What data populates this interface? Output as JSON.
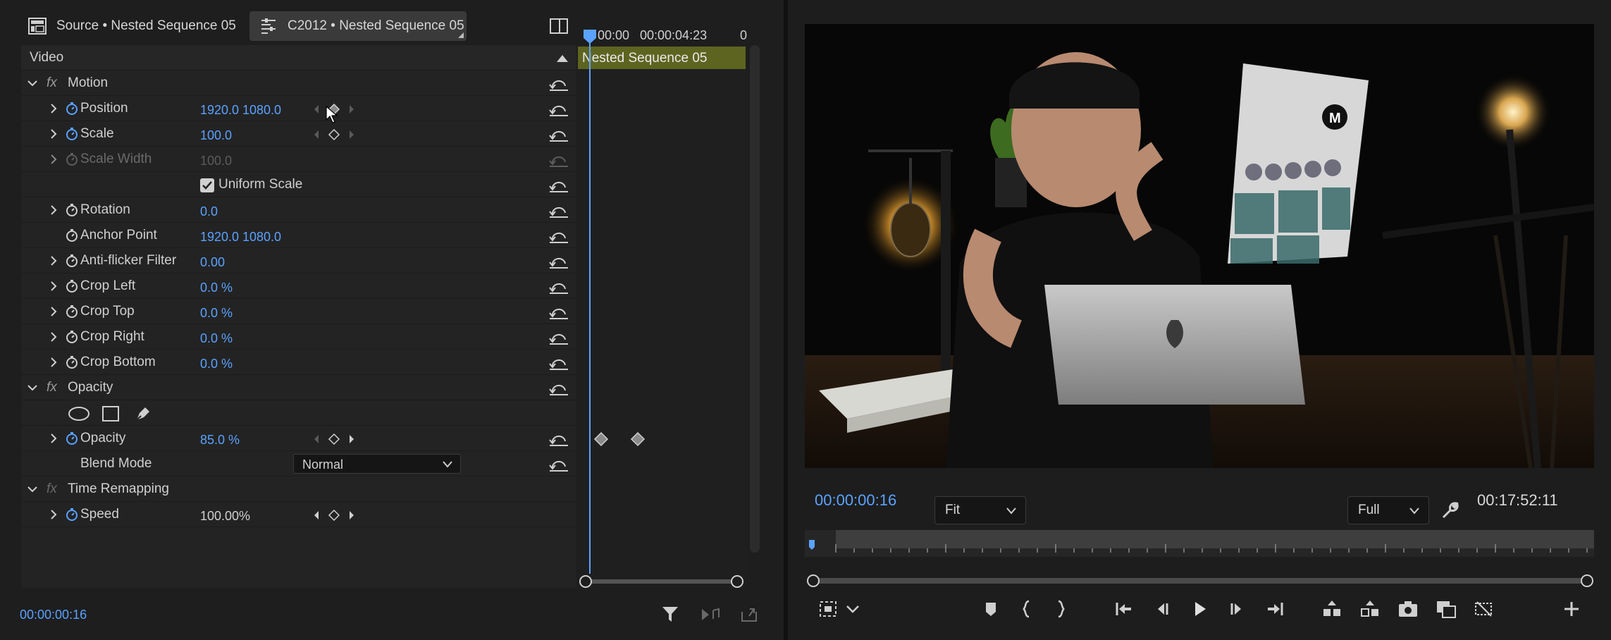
{
  "effect_controls": {
    "tabs": [
      {
        "label": "Source • Nested Sequence 05"
      },
      {
        "label": "C2012 • Nested Sequence 05"
      }
    ],
    "timeline_ruler": {
      "start": "00:00",
      "mid": "00:00:04:23",
      "end": "0"
    },
    "clip_name": "Nested Sequence 05",
    "section_video": "Video",
    "motion": {
      "label": "Motion",
      "position": {
        "label": "Position",
        "x": "1920.0",
        "y": "1080.0"
      },
      "scale": {
        "label": "Scale",
        "value": "100.0"
      },
      "scale_width": {
        "label": "Scale Width",
        "value": "100.0"
      },
      "uniform_scale": {
        "label": "Uniform Scale",
        "checked": true
      },
      "rotation": {
        "label": "Rotation",
        "value": "0.0"
      },
      "anchor_point": {
        "label": "Anchor Point",
        "x": "1920.0",
        "y": "1080.0"
      },
      "anti_flicker": {
        "label": "Anti-flicker Filter",
        "value": "0.00"
      },
      "crop_left": {
        "label": "Crop Left",
        "value": "0.0 %"
      },
      "crop_top": {
        "label": "Crop Top",
        "value": "0.0 %"
      },
      "crop_right": {
        "label": "Crop Right",
        "value": "0.0 %"
      },
      "crop_bottom": {
        "label": "Crop Bottom",
        "value": "0.0 %"
      }
    },
    "opacity": {
      "label": "Opacity",
      "opacity": {
        "label": "Opacity",
        "value": "85.0 %"
      },
      "blend_mode": {
        "label": "Blend Mode",
        "value": "Normal"
      }
    },
    "time_remapping": {
      "label": "Time Remapping",
      "speed": {
        "label": "Speed",
        "value": "100.00%"
      }
    },
    "current_time": "00:00:00:16"
  },
  "program_monitor": {
    "playhead_time": "00:00:00:16",
    "zoom": "Fit",
    "resolution": "Full",
    "duration": "00:17:52:11"
  },
  "colors": {
    "accent_blue": "#5aa2ff",
    "clip_bar": "#5d6420",
    "panel_bg": "#232323"
  }
}
